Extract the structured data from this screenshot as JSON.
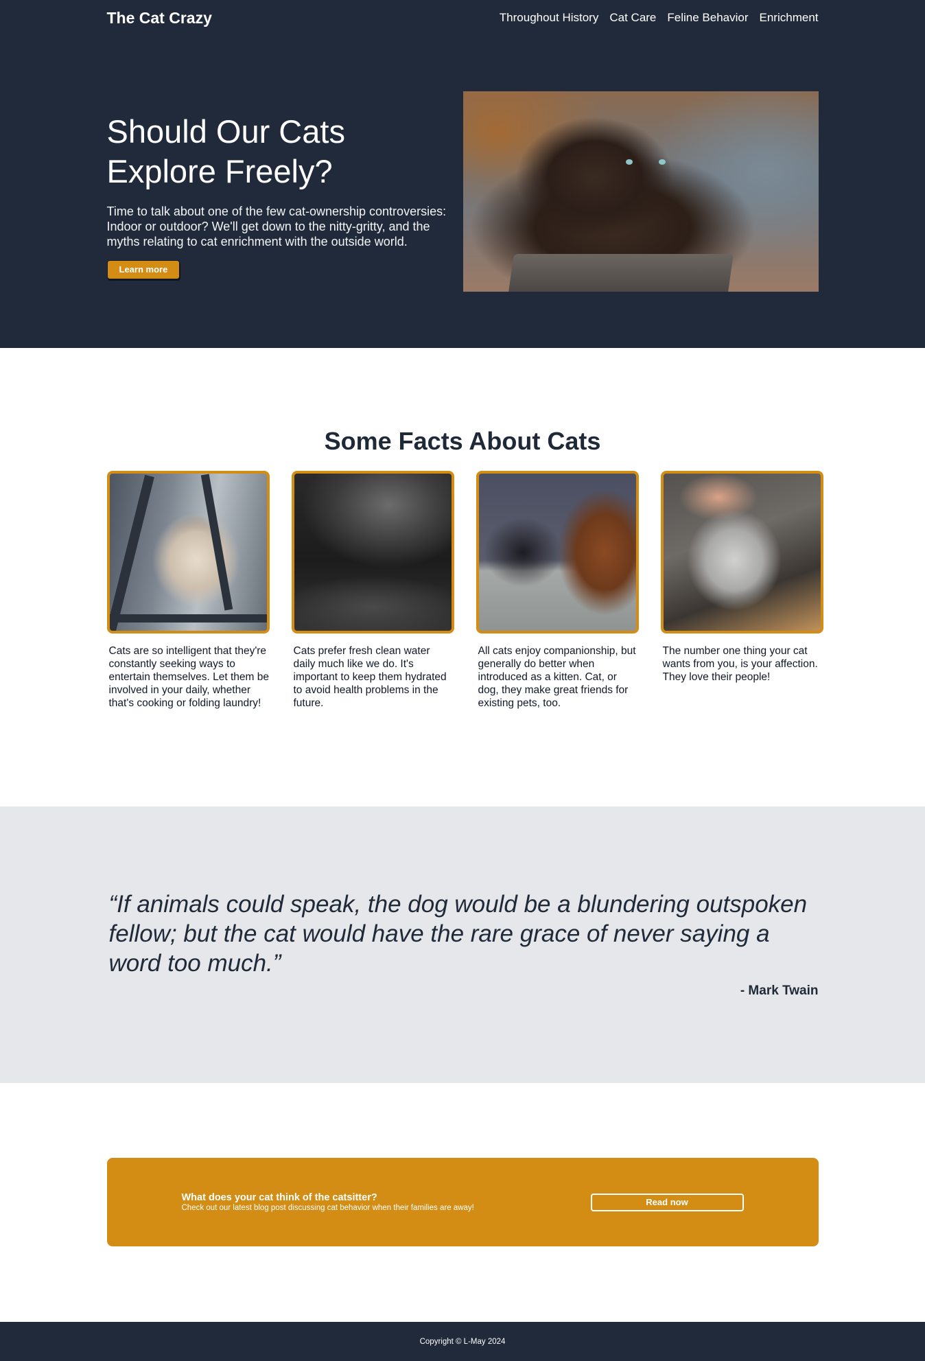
{
  "site": {
    "brand": "The Cat Crazy"
  },
  "nav": {
    "items": [
      "Throughout History",
      "Cat Care",
      "Feline Behavior",
      "Enrichment"
    ]
  },
  "hero": {
    "title": "Should Our Cats Explore Freely?",
    "lead": "Time to talk about one of the few cat-ownership controversies: Indoor or outdoor? We'll get down to the nitty-gritty, and the myths relating to cat enrichment with the outside world.",
    "button_label": "Learn more",
    "image": "dark-fluffy-cat-photo"
  },
  "facts": {
    "title": "Some Facts About Cats",
    "cards": [
      {
        "image": "ragdoll-cat-under-chair-photo",
        "text": "Cats are so intelligent that they're constantly seeking ways to entertain themselves. Let them be involved in your daily, whether that's cooking or folding laundry!"
      },
      {
        "image": "cat-drinking-water-photo",
        "text": "Cats prefer fresh clean water daily much like we do. It's important to keep them hydrated to avoid health problems in the future."
      },
      {
        "image": "black-cat-and-dog-photo",
        "text": "All cats enjoy companionship, but generally do better when introduced as a kitten. Cat, or dog, they make great friends for existing pets, too."
      },
      {
        "image": "cat-being-petted-photo",
        "text": "The number one thing your cat wants from you, is your affection. They love their people!"
      }
    ]
  },
  "quote": {
    "text": "“If animals could speak, the dog would be a blundering outspoken fellow; but the cat would have the rare grace of never saying a word too much.”",
    "author": "- Mark Twain"
  },
  "cta": {
    "title": "What does your cat think of the catsitter?",
    "subtitle": "Check out our latest blog post discussing cat behavior when their families are away!",
    "button_label": "Read now"
  },
  "footer": {
    "copyright": "Copyright © L-May 2024"
  },
  "colors": {
    "navy": "#212a3a",
    "accent": "#d48d14",
    "quote_bg": "#e5e7eb"
  }
}
